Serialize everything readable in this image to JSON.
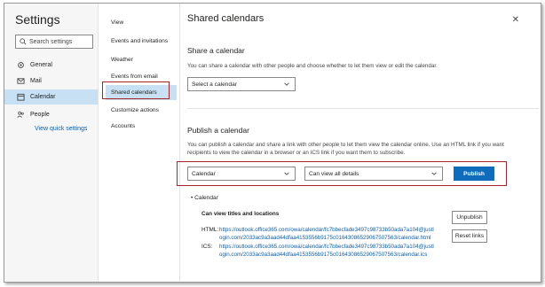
{
  "settings": {
    "title": "Settings",
    "search_placeholder": "Search settings",
    "nav": [
      {
        "label": "General",
        "icon": "gear-icon"
      },
      {
        "label": "Mail",
        "icon": "mail-icon"
      },
      {
        "label": "Calendar",
        "icon": "calendar-icon",
        "active": true
      },
      {
        "label": "People",
        "icon": "people-icon"
      }
    ],
    "quick_link": "View quick settings"
  },
  "subnav": {
    "items": [
      "View",
      "Events and invitations",
      "Weather",
      "Events from email",
      "Shared calendars",
      "Customize actions",
      "Accounts"
    ],
    "active_index": 4
  },
  "main": {
    "title": "Shared calendars",
    "share": {
      "heading": "Share a calendar",
      "description": "You can share a calendar with other people and choose whether to let them view or edit the calendar.",
      "select_label": "Select a calendar"
    },
    "publish": {
      "heading": "Publish a calendar",
      "description": "You can publish a calendar and share a link with other people to let them view the calendar online. Use an HTML link if you want recipients to view the calendar in a browser or an ICS link if you want them to subscribe.",
      "calendar_select": "Calendar",
      "permission_select": "Can view all details",
      "publish_button": "Publish",
      "published": {
        "name": "Calendar",
        "permission": "Can view titles and locations",
        "html_label": "HTML:",
        "html_url": "https://outlook.office365.com/owa/calendar/fc7bbecfade3497c98733b50ada7a104@justlogin.com/2033ac9a3aad44dfaa4153556b9175c01643086529067507563/calendar.html",
        "ics_label": "ICS:",
        "ics_url": "https://outlook.office365.com/owa/calendar/fc7bbecfade3497c98733b50ada7a104@justlogin.com/2033ac9a3aad44dfaa4153556b9175c01643086529067507563/calendar.ics",
        "unpublish_button": "Unpublish",
        "reset_button": "Reset links"
      }
    }
  },
  "colors": {
    "accent": "#0f6cbd",
    "highlight_border": "#a4262c",
    "selected_bg": "#c7e0f4",
    "link": "#0f5ea8"
  }
}
